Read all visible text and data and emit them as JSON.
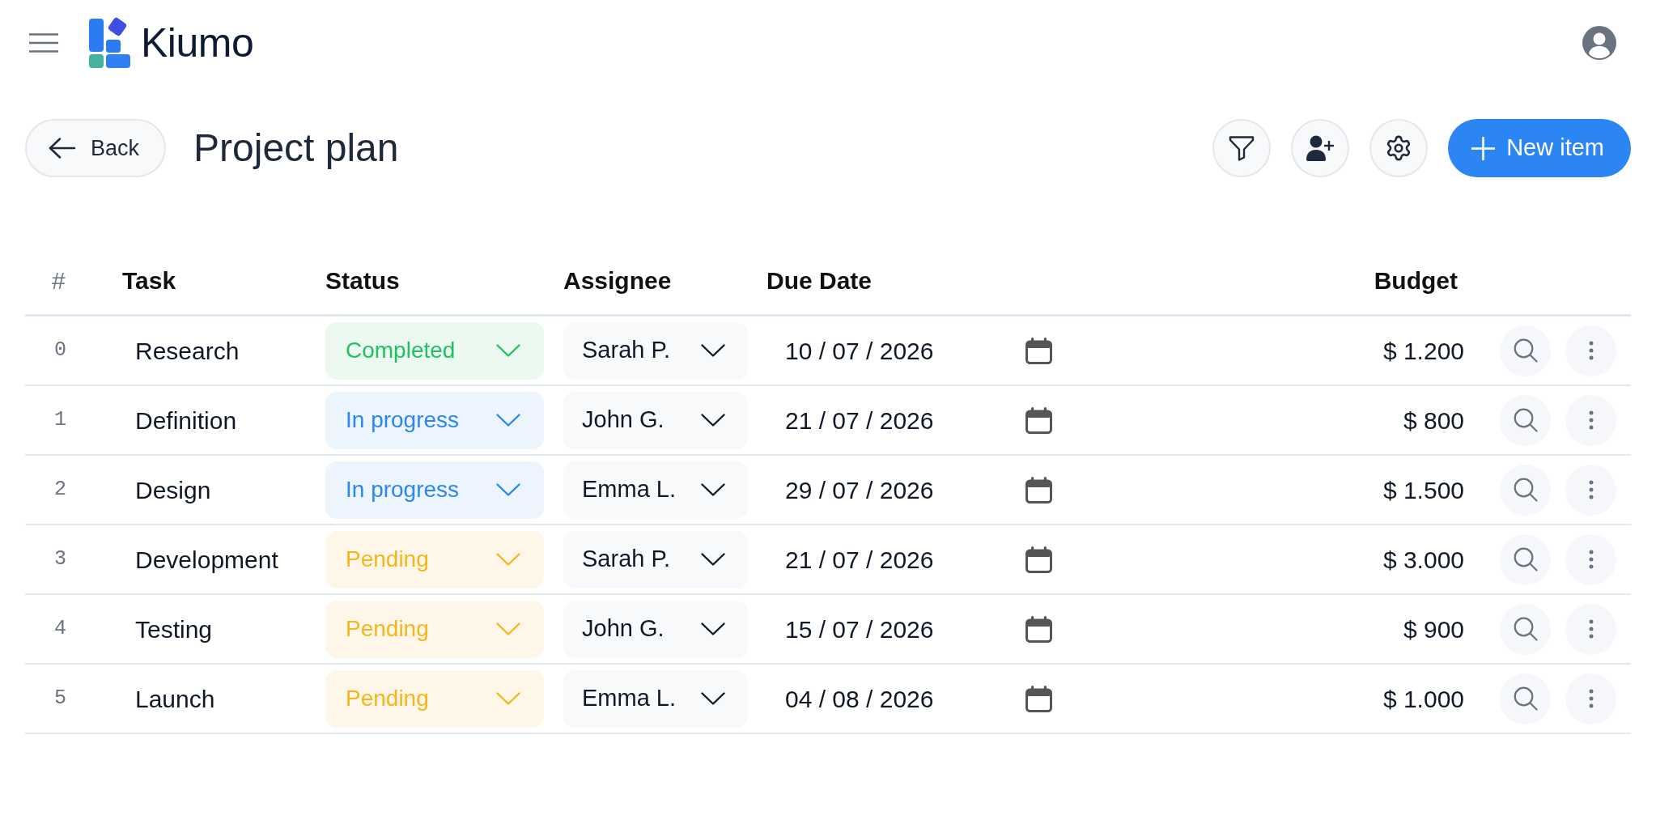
{
  "header": {
    "logo_text": "Kiumo"
  },
  "toolbar": {
    "back_button": "Back",
    "title": "Project plan",
    "new_button": "New item"
  },
  "table": {
    "columns": [
      "#",
      "Task",
      "Status",
      "Assignee",
      "Due Date",
      "Budget"
    ],
    "rows": [
      {
        "index": "0",
        "task": "Research",
        "status": {
          "label": "Completed",
          "kind": "completed"
        },
        "assignee": "Sarah P.",
        "due_date": "10 / 07 / 2026",
        "budget": "$ 1.200"
      },
      {
        "index": "1",
        "task": "Definition",
        "status": {
          "label": "In progress",
          "kind": "in_progress"
        },
        "assignee": "John G.",
        "due_date": "21 / 07 / 2026",
        "budget": "$ 800"
      },
      {
        "index": "2",
        "task": "Design",
        "status": {
          "label": "In progress",
          "kind": "in_progress"
        },
        "assignee": "Emma L.",
        "due_date": "29 / 07 / 2026",
        "budget": "$ 1.500"
      },
      {
        "index": "3",
        "task": "Development",
        "status": {
          "label": "Pending",
          "kind": "pending"
        },
        "assignee": "Sarah P.",
        "due_date": "21 / 07 / 2026",
        "budget": "$ 3.000"
      },
      {
        "index": "4",
        "task": "Testing",
        "status": {
          "label": "Pending",
          "kind": "pending"
        },
        "assignee": "John G.",
        "due_date": "15 / 07 / 2026",
        "budget": "$ 900"
      },
      {
        "index": "5",
        "task": "Launch",
        "status": {
          "label": "Pending",
          "kind": "pending"
        },
        "assignee": "Emma L.",
        "due_date": "04 / 08 / 2026",
        "budget": "$ 1.000"
      }
    ]
  }
}
